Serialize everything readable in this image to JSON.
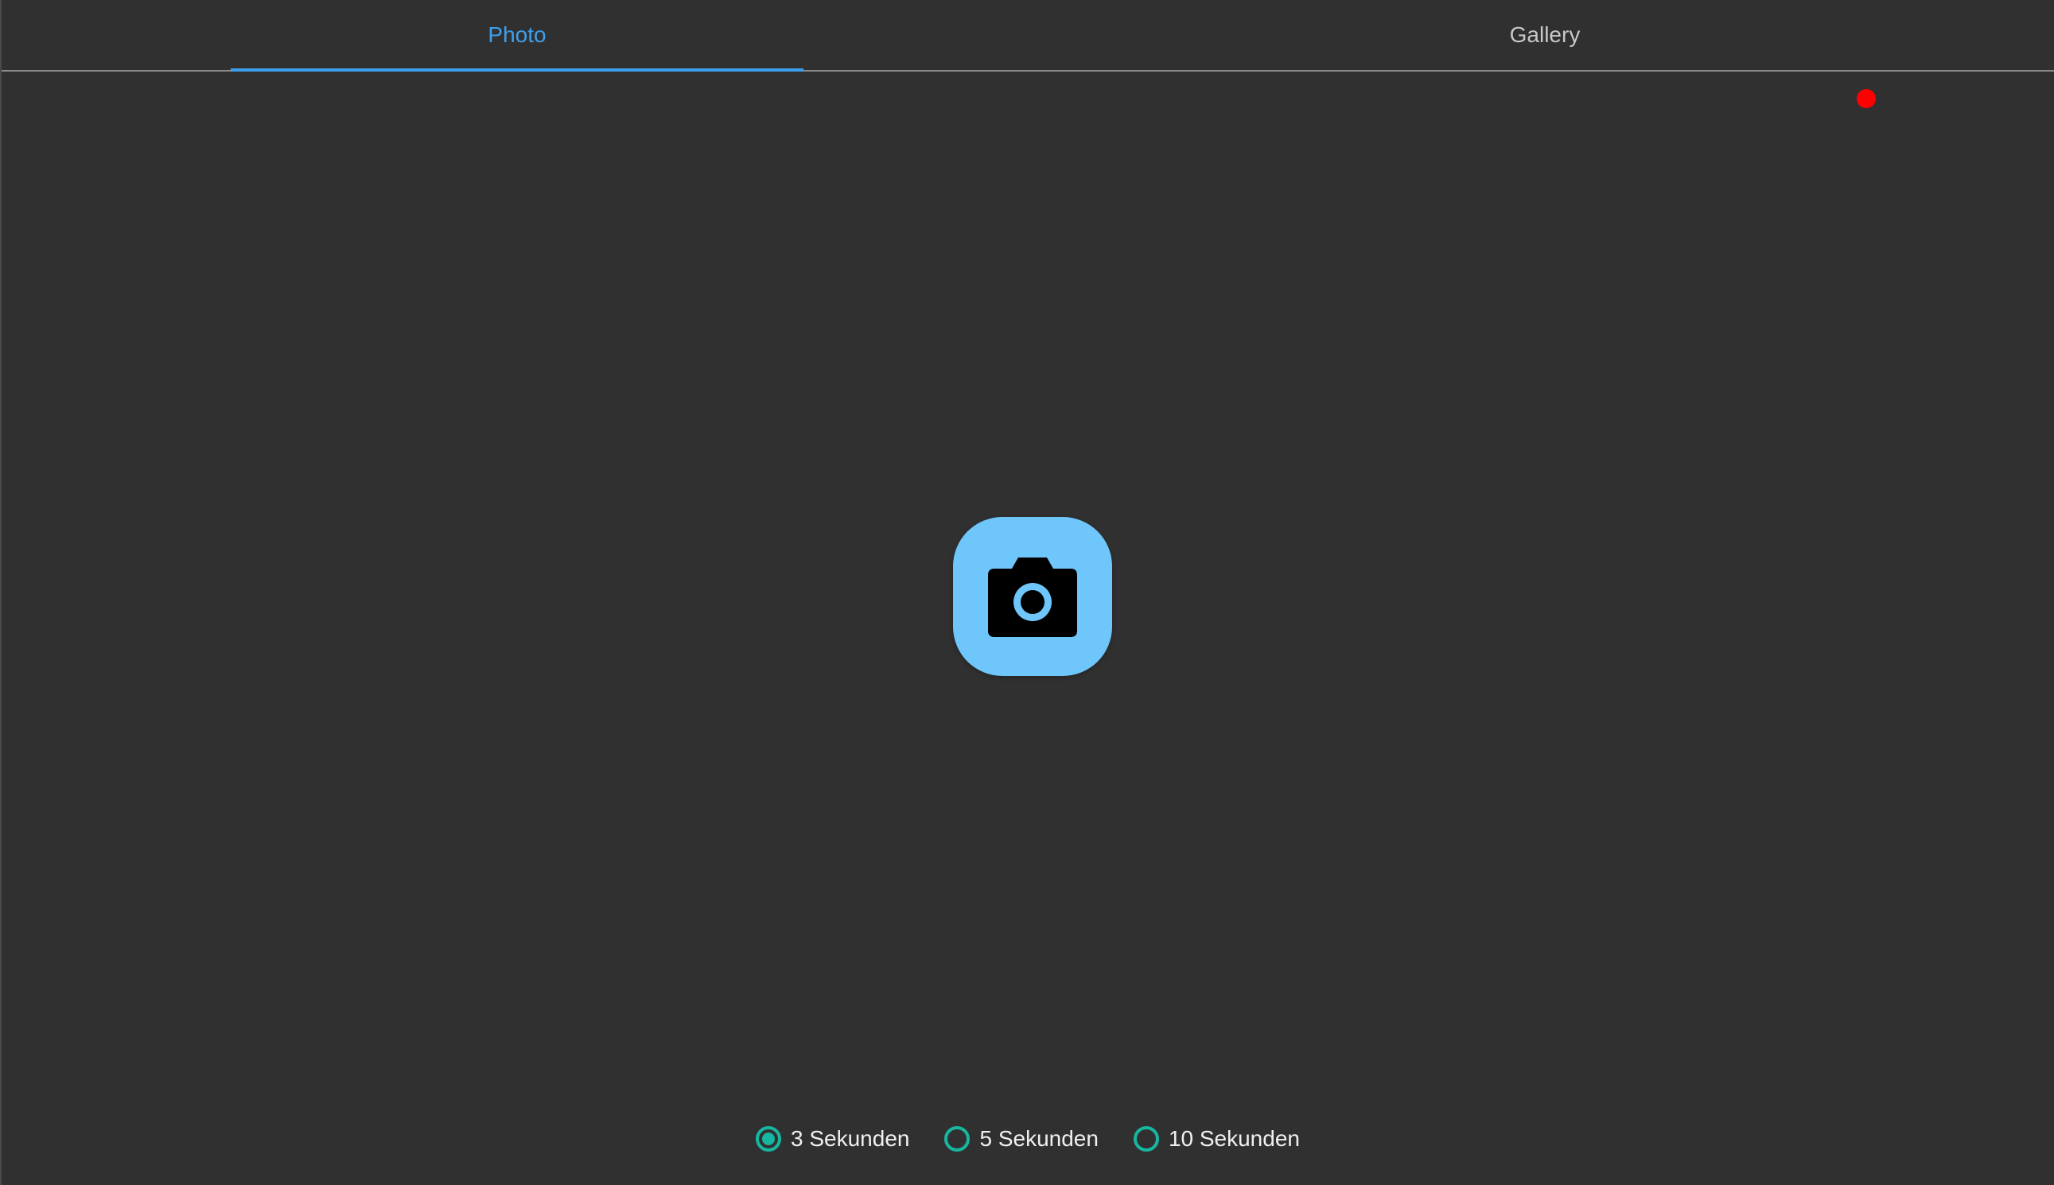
{
  "tabs": {
    "photo_label": "Photo",
    "gallery_label": "Gallery",
    "active": "Photo"
  },
  "status": {
    "recording_indicator_color": "#ff0000"
  },
  "capture": {
    "icon": "camera-icon",
    "button_color": "#6ec6fb"
  },
  "timer": {
    "options": [
      {
        "label": "3 Sekunden",
        "selected": true
      },
      {
        "label": "5 Sekunden",
        "selected": false
      },
      {
        "label": "10 Sekunden",
        "selected": false
      }
    ],
    "accent_color": "#17b6a0"
  },
  "colors": {
    "background": "#303030",
    "tab_active": "#3ea0ec",
    "tab_inactive": "#c8c8c8"
  }
}
